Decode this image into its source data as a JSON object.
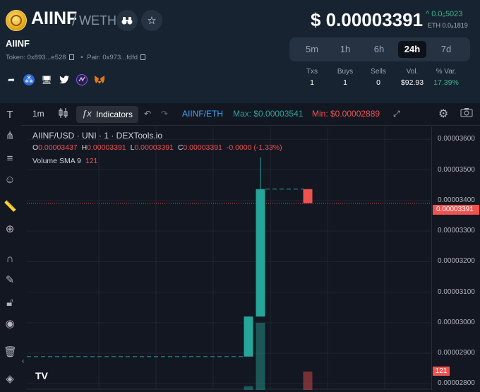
{
  "header": {
    "token_name": "AIINF",
    "pair_separator": "/",
    "pair_quote": "WETH",
    "subtitle": "AIINF",
    "token_label": "Token: 0x893...e528",
    "pair_label": "Pair: 0x973...fdfd",
    "price": "$ 0.00003391",
    "change": "0.0₅5023",
    "eth_price": "ETH 0.0₈1819",
    "timeframes": [
      "5m",
      "1h",
      "6h",
      "24h",
      "7d"
    ],
    "active_timeframe": "24h",
    "stats": {
      "headers": [
        "Txs",
        "Buys",
        "Sells",
        "Vol.",
        "% Var."
      ],
      "values": [
        "1",
        "1",
        "0",
        "$92.93",
        "17.39%"
      ]
    }
  },
  "toolbar": {
    "interval": "1m",
    "indicators_label": "Indicators",
    "symbol": "AIINF/ETH",
    "max_label": "Max: $0.00003541",
    "min_label": "Min: $0.00002889"
  },
  "legend": {
    "title": "AIINF/USD · UNI · 1 · DEXTools.io",
    "o_label": "O",
    "o_val": "0.00003437",
    "h_label": "H",
    "h_val": "0.00003391",
    "l_label": "L",
    "l_val": "0.00003391",
    "c_label": "C",
    "c_val": "0.00003391",
    "change": "-0.0000 (-1.33%)",
    "volume_label": "Volume SMA 9",
    "volume_val": "121"
  },
  "yaxis": {
    "labels": [
      "0.00003600",
      "0.00003500",
      "0.00003400",
      "0.00003300",
      "0.00003200",
      "0.00003100",
      "0.00003000",
      "0.00002900",
      "0.00002800"
    ],
    "price_tag": "0.00003391",
    "volume_tag": "121"
  },
  "brand": {
    "tv_logo": "TV"
  },
  "colors": {
    "up": "#26a69a",
    "down": "#ef5350",
    "accent": "#3fb68b"
  },
  "chart_data": {
    "type": "candlestick",
    "ylim": [
      2.78e-05,
      3.64e-05
    ],
    "candles": [
      {
        "open": 2.889e-05,
        "high": 3.02e-05,
        "low": 2.889e-05,
        "close": 3.02e-05,
        "volume": 5
      },
      {
        "open": 3.02e-05,
        "high": 3.541e-05,
        "low": 3.02e-05,
        "close": 3.437e-05,
        "volume": 92
      },
      {
        "open": 3.437e-05,
        "high": 3.437e-05,
        "low": 3.391e-05,
        "close": 3.391e-05,
        "volume": 25
      }
    ]
  }
}
